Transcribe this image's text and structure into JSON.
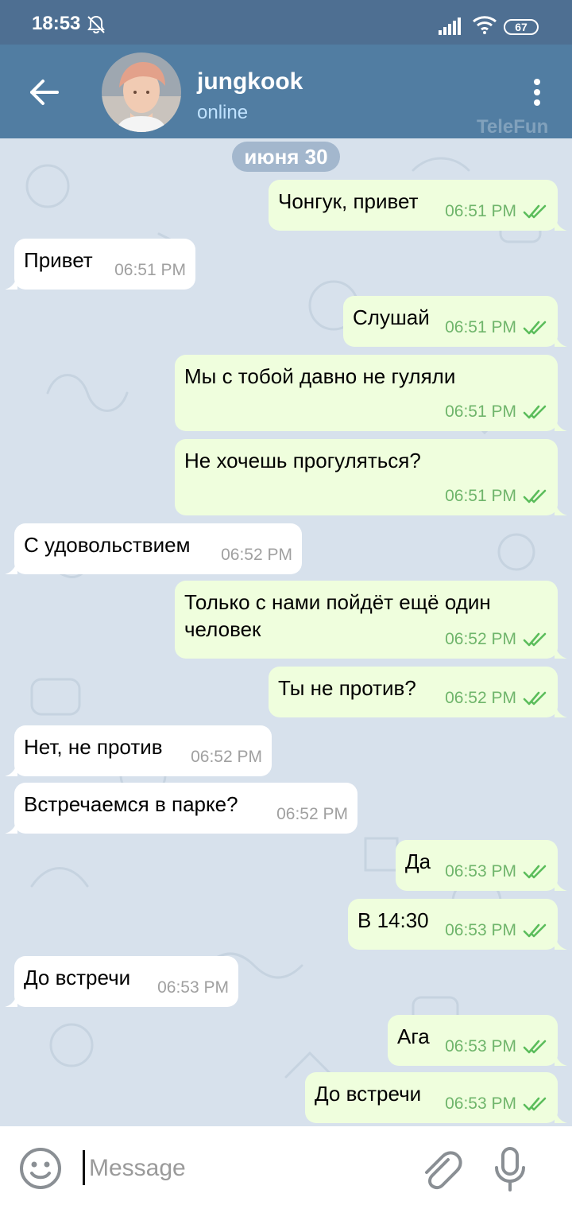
{
  "status_bar": {
    "time": "18:53",
    "battery": "67"
  },
  "header": {
    "name": "jungkook",
    "status": "online",
    "watermark": "TeleFun"
  },
  "date_badge": "июня 30",
  "messages": [
    {
      "dir": "out",
      "text": "Чонгук, привет",
      "time": "06:51 PM"
    },
    {
      "dir": "in",
      "text": "Привет",
      "time": "06:51 PM"
    },
    {
      "dir": "out",
      "text": "Слушай",
      "time": "06:51 PM"
    },
    {
      "dir": "out",
      "text": "Мы с тобой давно не гуляли",
      "time": "06:51 PM"
    },
    {
      "dir": "out",
      "text": "Не хочешь прогуляться?",
      "time": "06:51 PM"
    },
    {
      "dir": "in",
      "text": "С удовольствием",
      "time": "06:52 PM"
    },
    {
      "dir": "out",
      "text": "Только с нами пойдёт ещё один человек",
      "time": "06:52 PM"
    },
    {
      "dir": "out",
      "text": "Ты не против?",
      "time": "06:52 PM"
    },
    {
      "dir": "in",
      "text": "Нет, не против",
      "time": "06:52 PM"
    },
    {
      "dir": "in",
      "text": "Встречаемся в парке?",
      "time": "06:52 PM"
    },
    {
      "dir": "out",
      "text": "Да",
      "time": "06:53 PM"
    },
    {
      "dir": "out",
      "text": "В 14:30",
      "time": "06:53 PM"
    },
    {
      "dir": "in",
      "text": "До встречи",
      "time": "06:53 PM"
    },
    {
      "dir": "out",
      "text": "Ага",
      "time": "06:53 PM"
    },
    {
      "dir": "out",
      "text": "До встречи",
      "time": "06:53 PM"
    }
  ],
  "input": {
    "placeholder": "Message"
  },
  "colors": {
    "header": "#517da2",
    "status_bar": "#4e6f92",
    "outgoing_bubble": "#effedd",
    "incoming_bubble": "#ffffff",
    "read_ticks": "#5bbd5b",
    "chat_background": "#d7e1ec"
  }
}
